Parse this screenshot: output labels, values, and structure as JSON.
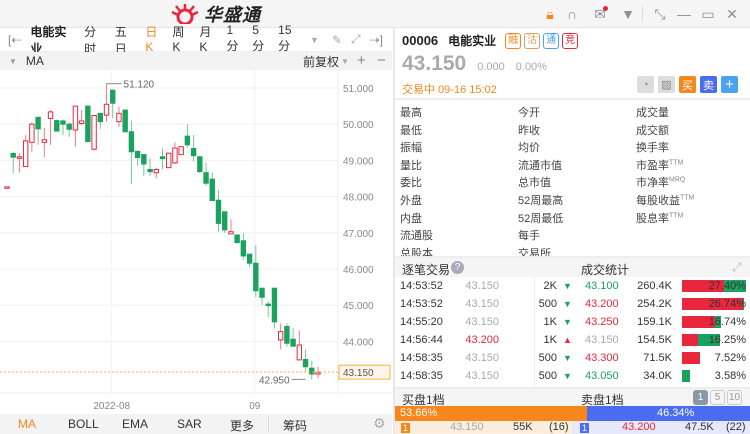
{
  "app": {
    "logo_text": "华盛通"
  },
  "window_icons": [
    "lock-icon",
    "headset-icon",
    "mail-icon",
    "shirt-icon",
    "shrink-icon",
    "minimize-icon",
    "maximize-icon",
    "close-icon"
  ],
  "toolbar": {
    "stock_name": "电能实业",
    "periods": [
      "分时",
      "五日",
      "日K",
      "周K",
      "月K",
      "1分",
      "5分",
      "15分"
    ],
    "active_period": "日K"
  },
  "indicator_row": {
    "label": "MA",
    "adjust": "前复权"
  },
  "chart_data": {
    "type": "candlestick",
    "y_ticks": [
      "51.000",
      "50.000",
      "49.000",
      "48.000",
      "47.000",
      "46.000",
      "45.000",
      "44.000"
    ],
    "y_tick_values": [
      51,
      50,
      49,
      48,
      47,
      46,
      45,
      44
    ],
    "x_labels": [
      "2022-08",
      "09"
    ],
    "x_label_index": [
      17,
      40
    ],
    "ylim": [
      42.85,
      51.45
    ],
    "max_label": "51.120",
    "max_value": 51.12,
    "max_index": 16,
    "min_label": "42.950",
    "min_value": 42.95,
    "min_index": 48,
    "last_price_label": "43.150",
    "last_price": 43.15,
    "ohlc": [
      [
        48.27,
        48.9,
        48.9,
        48.27
      ],
      [
        49.19,
        49.24,
        48.64,
        49.09
      ],
      [
        49.09,
        49.2,
        48.66,
        49.1
      ],
      [
        48.83,
        49.7,
        48.83,
        49.54
      ],
      [
        49.5,
        50.05,
        49.24,
        50.0
      ],
      [
        50.19,
        50.19,
        49.43,
        49.87
      ],
      [
        49.5,
        49.9,
        49.09,
        49.57
      ],
      [
        50.16,
        50.39,
        49.43,
        50.34
      ],
      [
        50.1,
        50.13,
        49.8,
        49.81
      ],
      [
        50.09,
        50.13,
        49.7,
        50.0
      ],
      [
        50.0,
        50.05,
        49.65,
        49.86
      ],
      [
        49.84,
        50.5,
        49.38,
        50.5
      ],
      [
        50.02,
        50.39,
        49.97,
        50.09
      ],
      [
        50.5,
        50.5,
        49.52,
        49.52
      ],
      [
        49.31,
        50.24,
        49.27,
        50.24
      ],
      [
        50.3,
        50.3,
        49.86,
        50.07
      ],
      [
        50.25,
        51.12,
        50.07,
        50.55
      ],
      [
        50.94,
        50.94,
        50.16,
        50.58
      ],
      [
        50.07,
        50.48,
        49.92,
        50.3
      ],
      [
        50.39,
        50.39,
        49.79,
        49.79
      ],
      [
        49.79,
        50.1,
        48.35,
        49.24
      ],
      [
        49.25,
        49.27,
        48.85,
        49.08
      ],
      [
        49.16,
        49.16,
        48.58,
        48.9
      ],
      [
        48.75,
        49.05,
        48.58,
        48.69
      ],
      [
        48.66,
        48.8,
        48.5,
        48.75
      ],
      [
        49.1,
        49.33,
        48.75,
        49.05
      ],
      [
        48.8,
        49.2,
        48.8,
        49.2
      ],
      [
        48.93,
        49.5,
        48.9,
        49.34
      ],
      [
        49.16,
        49.38,
        49.16,
        49.38
      ],
      [
        49.67,
        50.0,
        49.36,
        49.43
      ],
      [
        49.33,
        49.7,
        48.97,
        49.13
      ],
      [
        49.1,
        49.13,
        48.65,
        48.69
      ],
      [
        48.66,
        48.94,
        48.3,
        48.37
      ],
      [
        48.48,
        48.66,
        47.89,
        47.89
      ],
      [
        47.9,
        48.18,
        47.03,
        47.26
      ],
      [
        47.58,
        47.58,
        47.0,
        47.08
      ],
      [
        46.97,
        47.37,
        46.97,
        47.03
      ],
      [
        46.94,
        46.94,
        46.7,
        46.73
      ],
      [
        46.78,
        46.99,
        46.25,
        46.36
      ],
      [
        46.41,
        46.41,
        46.05,
        46.16
      ],
      [
        46.16,
        46.66,
        45.23,
        45.4
      ],
      [
        45.47,
        45.47,
        45.01,
        45.22
      ],
      [
        45.03,
        45.1,
        44.67,
        45.02
      ],
      [
        45.47,
        45.47,
        44.36,
        44.54
      ],
      [
        44.04,
        44.5,
        43.78,
        44.27
      ],
      [
        44.41,
        44.5,
        43.86,
        43.95
      ],
      [
        44.06,
        44.36,
        43.84,
        43.87
      ],
      [
        43.49,
        44.31,
        43.49,
        43.9
      ],
      [
        43.5,
        43.78,
        43.16,
        43.3
      ],
      [
        43.26,
        43.47,
        42.95,
        43.1
      ],
      [
        43.1,
        43.3,
        42.98,
        43.15
      ]
    ],
    "colors": {
      "up": "#e8273c",
      "down": "#1aa25e"
    }
  },
  "bottom_tabs": {
    "items": [
      "MA",
      "BOLL",
      "EMA",
      "SAR",
      "更多",
      "筹码"
    ],
    "active": "MA"
  },
  "quote": {
    "code": "00006",
    "name": "电能实业",
    "badges": [
      "融",
      "沽",
      "通",
      "竞"
    ],
    "price": "43.150",
    "change": "0.000",
    "change_pct": "0.00%",
    "status": "交易中 09-16 15:02",
    "buy_label": "买",
    "sell_label": "卖",
    "plus_label": "+"
  },
  "stats": [
    [
      "最高",
      "今开",
      "成交量"
    ],
    [
      "最低",
      "昨收",
      "成交额"
    ],
    [
      "振幅",
      "均价",
      "换手率"
    ],
    [
      "量比",
      "流通市值",
      "市盈率"
    ],
    [
      "委比",
      "总市值",
      "市净率"
    ],
    [
      "外盘",
      "52周最高",
      "每股收益"
    ],
    [
      "内盘",
      "52周最低",
      "股息率"
    ],
    [
      "流通股",
      "每手",
      ""
    ],
    [
      "总股本",
      "交易所",
      ""
    ]
  ],
  "stats_sup": {
    "3": "TTM",
    "4": "MRQ",
    "5": "TTM",
    "6": "TTM"
  },
  "trades": {
    "title": "逐笔交易",
    "help": "?",
    "rows": [
      {
        "time": "14:53:52",
        "price": "43.150",
        "vol": "2K",
        "dir": "down",
        "pc": "#aaa"
      },
      {
        "time": "14:53:52",
        "price": "43.150",
        "vol": "500",
        "dir": "down",
        "pc": "#aaa"
      },
      {
        "time": "14:55:20",
        "price": "43.150",
        "vol": "1K",
        "dir": "down",
        "pc": "#aaa"
      },
      {
        "time": "14:56:44",
        "price": "43.200",
        "vol": "1K",
        "dir": "up",
        "pc": "#e8273c"
      },
      {
        "time": "14:58:35",
        "price": "43.150",
        "vol": "500",
        "dir": "down",
        "pc": "#aaa"
      },
      {
        "time": "14:58:35",
        "price": "43.150",
        "vol": "500",
        "dir": "down",
        "pc": "#aaa"
      }
    ]
  },
  "volume_stats": {
    "title": "成交统计",
    "rows": [
      {
        "price": "43.100",
        "vol": "260.4K",
        "pct": "27.40%",
        "p": 27.4,
        "buy": 0.66,
        "pc": "#1aa25e"
      },
      {
        "price": "43.200",
        "vol": "254.2K",
        "pct": "26.74%",
        "p": 26.74,
        "buy": 0.97,
        "pc": "#e8273c"
      },
      {
        "price": "43.250",
        "vol": "159.1K",
        "pct": "16.74%",
        "p": 16.74,
        "buy": 0.85,
        "pc": "#e8273c"
      },
      {
        "price": "43.150",
        "vol": "154.5K",
        "pct": "16.25%",
        "p": 16.25,
        "buy": 0.43,
        "pc": "#aaa"
      },
      {
        "price": "43.300",
        "vol": "71.5K",
        "pct": "7.52%",
        "p": 7.52,
        "buy": 1.0,
        "pc": "#e8273c"
      },
      {
        "price": "43.050",
        "vol": "34.0K",
        "pct": "3.58%",
        "p": 3.58,
        "buy": 0.0,
        "pc": "#1aa25e"
      }
    ]
  },
  "order_book": {
    "bid_title": "买盘1档",
    "ask_title": "卖盘1档",
    "levels": [
      "1",
      "5",
      "10"
    ],
    "bid_pct": "53.66%",
    "ask_pct": "46.34%",
    "bid_ratio": 53.66,
    "bid": {
      "level": "1",
      "price": "43.150",
      "vol": "55K",
      "count": "(16)"
    },
    "ask": {
      "level": "1",
      "price": "43.200",
      "vol": "47.5K",
      "count": "(22)"
    }
  }
}
